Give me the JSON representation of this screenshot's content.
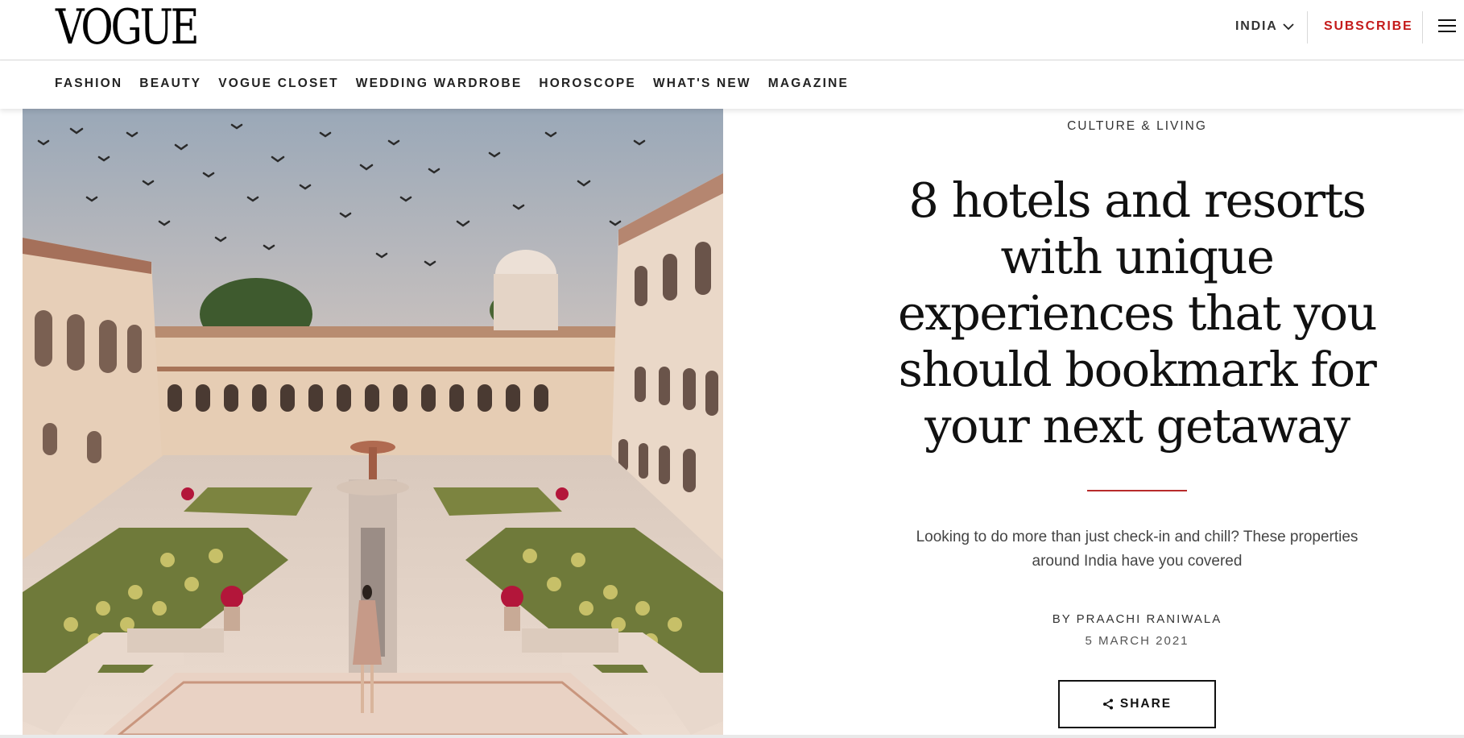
{
  "header": {
    "logo": "VOGUE",
    "edition": "INDIA",
    "subscribe": "SUBSCRIBE",
    "brand_accent": "#c41a1a"
  },
  "nav": {
    "items": [
      "FASHION",
      "BEAUTY",
      "VOGUE CLOSET",
      "WEDDING WARDROBE",
      "HOROSCOPE",
      "WHAT'S NEW",
      "MAGAZINE"
    ]
  },
  "article": {
    "rubric": "CULTURE & LIVING",
    "headline": "8 hotels and resorts with unique experiences that you should bookmark for your next getaway",
    "dek": "Looking to do more than just check-in and chill? These properties around India have you covered",
    "byline": "BY PRAACHI RANIWALA",
    "date": "5 MARCH 2021",
    "share": "SHARE"
  },
  "icons": {
    "edition_dropdown": "chevron-down-icon",
    "menu": "hamburger-menu-icon",
    "share": "share-icon"
  }
}
